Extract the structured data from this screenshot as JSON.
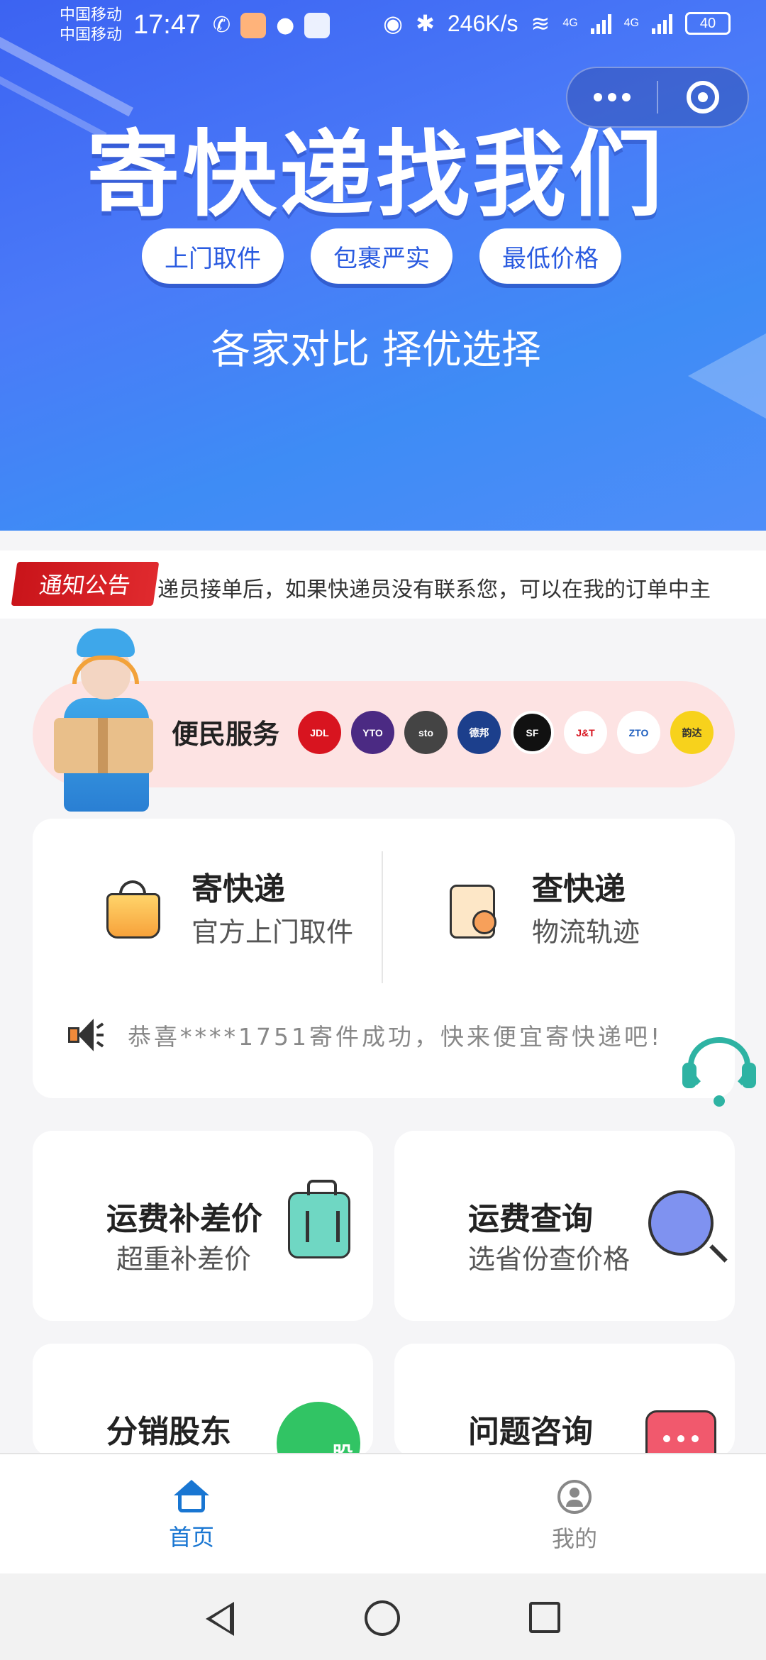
{
  "status_bar": {
    "carrier1": "中国移动",
    "carrier2": "中国移动",
    "time": "17:47",
    "speed": "246K/s",
    "network1": "4G",
    "network2": "4G",
    "battery": "40"
  },
  "banner": {
    "title": "寄快递找我们",
    "pills": [
      "上门取件",
      "包裹严实",
      "最低价格"
    ],
    "subtitle": "各家对比 择优选择"
  },
  "notice": {
    "tag": "通知公告",
    "text": "递员接单后，如果快递员没有联系您，可以在我的订单中主"
  },
  "service": {
    "title": "便民服务",
    "logos": [
      {
        "name": "JDL",
        "color": "#d8141f"
      },
      {
        "name": "YTO",
        "color": "#4b2a83"
      },
      {
        "name": "sto",
        "color": "#444444"
      },
      {
        "name": "德邦",
        "color": "#1c3f8c"
      },
      {
        "name": "SF",
        "color": "#111111"
      },
      {
        "name": "J&T",
        "color": "#ffffff"
      },
      {
        "name": "ZTO",
        "color": "#ffffff"
      },
      {
        "name": "韵达",
        "color": "#f7d21c"
      }
    ]
  },
  "main_card": {
    "send_title": "寄快递",
    "send_sub": "官方上门取件",
    "track_title": "查快递",
    "track_sub": "物流轨迹",
    "ticker": "恭喜****1751寄件成功，快来便宜寄快递吧!"
  },
  "grid": [
    {
      "title": "运费补差价",
      "sub": "超重补差价"
    },
    {
      "title": "运费查询",
      "sub": "选省份查价格"
    },
    {
      "title": "分销股东",
      "sub": "",
      "badge": "股"
    },
    {
      "title": "问题咨询",
      "sub": ""
    }
  ],
  "tabbar": {
    "home": "首页",
    "mine": "我的",
    "active_color": "#1976d2"
  }
}
